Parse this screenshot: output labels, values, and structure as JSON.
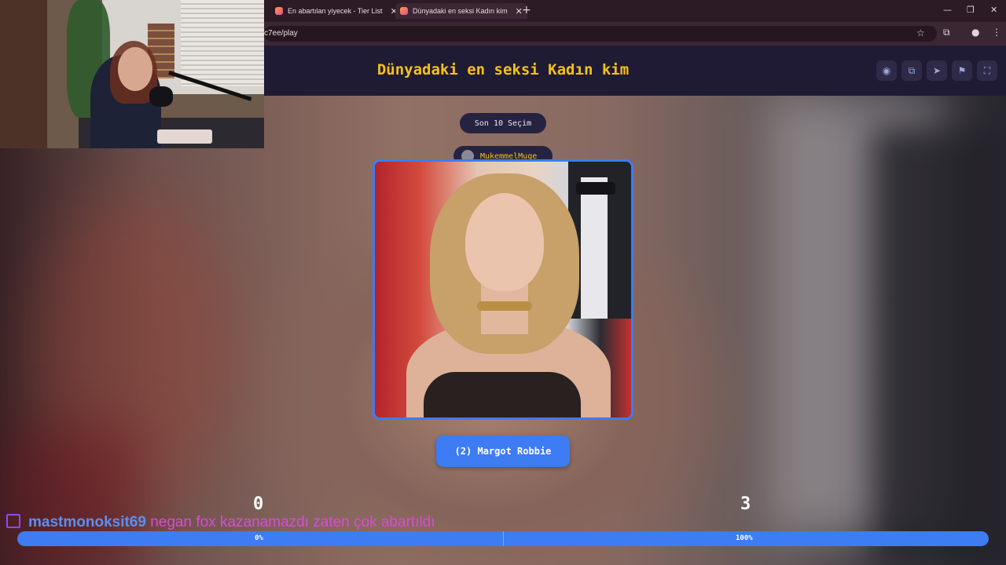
{
  "browser": {
    "tabs": [
      {
        "label": "En abartılan yiyecek - Tier List"
      },
      {
        "label": "Dünyadaki en seksi Kadın kim"
      }
    ],
    "url": "c7ee/play"
  },
  "app": {
    "title": "Dünyadaki en seksi Kadın kim",
    "header_icons": [
      "eye-icon",
      "copy-icon",
      "send-icon",
      "flag-icon",
      "fullscreen-icon"
    ]
  },
  "game": {
    "recent_label": "Son 10 Seçim",
    "user_chip": "MukemmelMuge",
    "candidate_label": "(2) Margot Robbie",
    "score_left": "0",
    "score_right": "3",
    "progress_left": "0%",
    "progress_right": "100%"
  },
  "chat": {
    "username": "mastmonoksit69",
    "message": "negan fox kazanamazdı zaten çok abartıldı"
  },
  "colors": {
    "accent_blue": "#3d7cf2",
    "title_yellow": "#f4c21b",
    "header_bg": "#201b34",
    "twitch_purple": "#9146ff"
  }
}
